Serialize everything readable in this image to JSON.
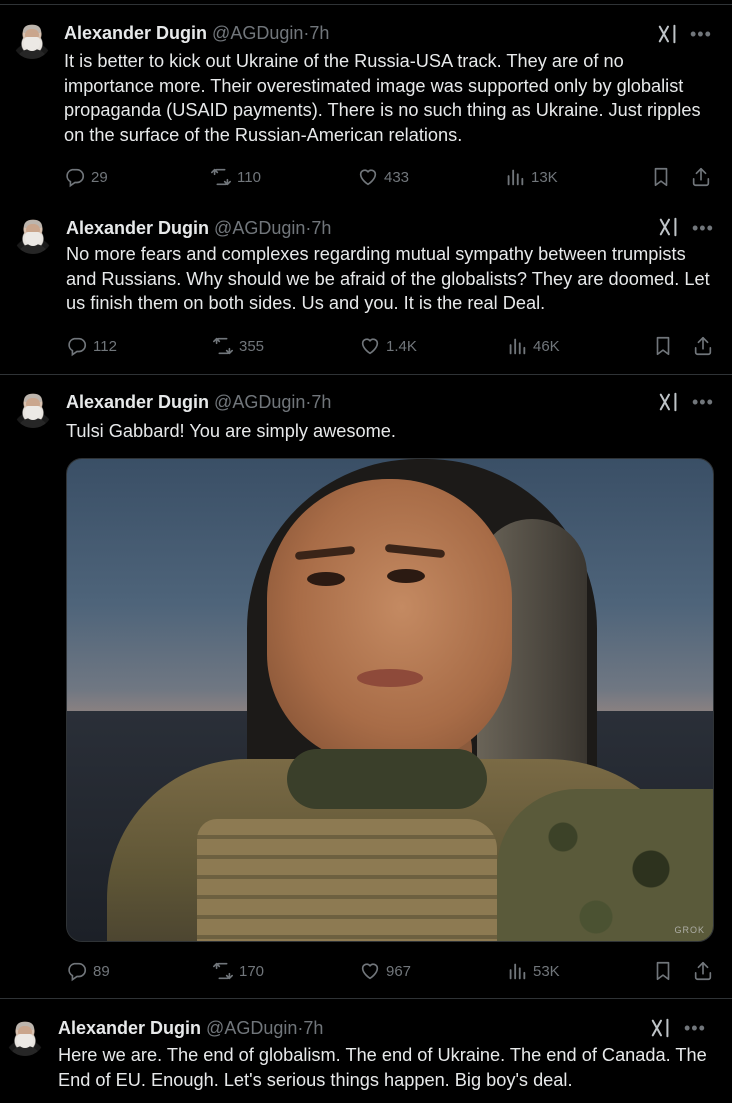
{
  "colors": {
    "background": "#000000",
    "text": "#e7e9ea",
    "muted": "#71767b",
    "divider": "#2f3336"
  },
  "tweets": [
    {
      "name": "Alexander Dugin",
      "handle": "@AGDugin",
      "separator": "·",
      "time": "7h",
      "text": "It is better to kick out Ukraine of the Russia-USA track. They are of no importance more. Their overestimated image was supported only by globalist propaganda (USAID payments). There is no such thing as Ukraine. Just ripples on the surface of the Russian-American relations.",
      "replies": "29",
      "reposts": "110",
      "likes": "433",
      "views": "13K"
    },
    {
      "name": "Alexander Dugin",
      "handle": "@AGDugin",
      "separator": "·",
      "time": "7h",
      "text": "No more fears and complexes regarding mutual sympathy between trumpists and Russians. Why should we be afraid of the globalists? They are doomed. Let us finish them on both sides. Us and you. It is the real Deal.",
      "replies": "112",
      "reposts": "355",
      "likes": "1.4K",
      "views": "46K"
    },
    {
      "name": "Alexander Dugin",
      "handle": "@AGDugin",
      "separator": "·",
      "time": "7h",
      "text": "Tulsi Gabbard! You are simply awesome.",
      "media_watermark": "GROK",
      "replies": "89",
      "reposts": "170",
      "likes": "967",
      "views": "53K"
    },
    {
      "name": "Alexander Dugin",
      "handle": "@AGDugin",
      "separator": "·",
      "time": "7h",
      "text": "Here we are. The end of globalism. The end of Ukraine. The end of Canada. The End of EU. Enough. Let's serious things happen. Big boy's deal."
    }
  ],
  "icons": [
    "grok-icon",
    "more-icon",
    "reply-icon",
    "repost-icon",
    "like-icon",
    "views-icon",
    "bookmark-icon",
    "share-icon"
  ]
}
